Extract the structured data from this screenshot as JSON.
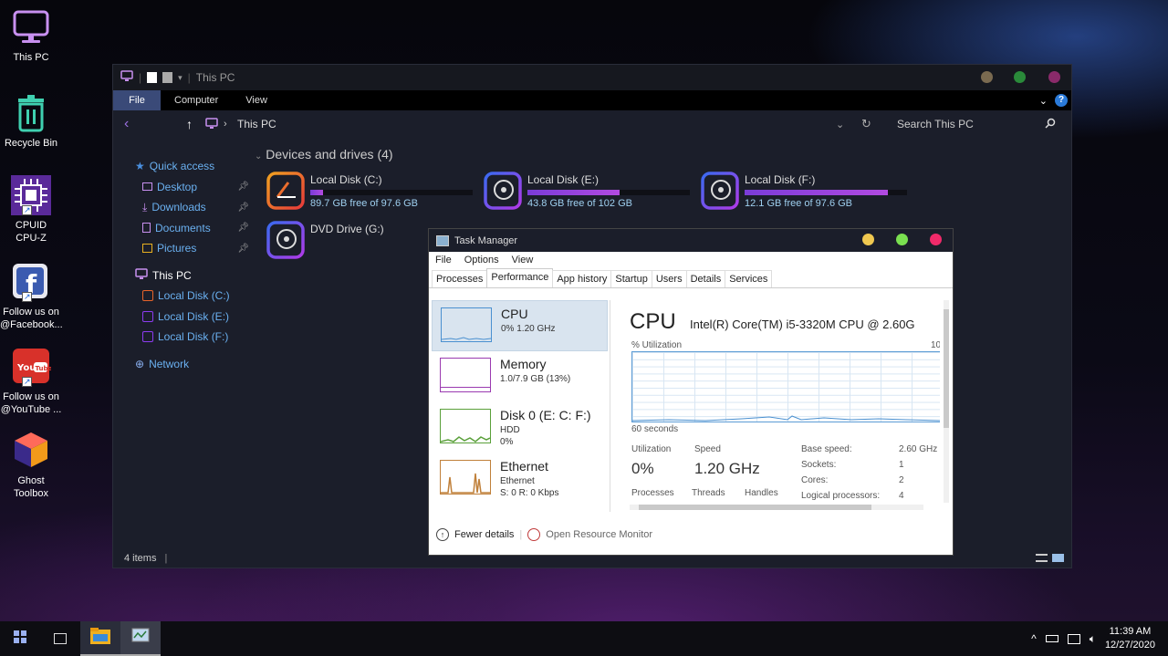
{
  "desktop": {
    "icons": [
      {
        "label": "This PC"
      },
      {
        "label": "Recycle Bin"
      },
      {
        "label_line1": "CPUID",
        "label_line2": "CPU-Z"
      },
      {
        "label_line1": "Follow us on",
        "label_line2": "@Facebook..."
      },
      {
        "label_line1": "Follow us on",
        "label_line2": "@YouTube ..."
      },
      {
        "label_line1": "Ghost",
        "label_line2": "Toolbox"
      }
    ]
  },
  "explorer": {
    "title": "This PC",
    "menu": [
      "File",
      "Computer",
      "View"
    ],
    "address": "This PC",
    "search_placeholder": "Search This PC",
    "sidebar": {
      "quick_access": "Quick access",
      "quick_items": [
        "Desktop",
        "Downloads",
        "Documents",
        "Pictures"
      ],
      "this_pc": "This PC",
      "drives": [
        "Local Disk (C:)",
        "Local Disk (E:)",
        "Local Disk (F:)"
      ],
      "network": "Network"
    },
    "section_title": "Devices and drives (4)",
    "drives": [
      {
        "name": "Local Disk (C:)",
        "free": "89.7 GB free of 97.6 GB",
        "used_fraction": 0.08,
        "color": "#e8642a"
      },
      {
        "name": "Local Disk (E:)",
        "free": "43.8 GB free of 102 GB",
        "used_fraction": 0.57,
        "color": "#8c3cf0"
      },
      {
        "name": "Local Disk (F:)",
        "free": "12.1 GB free of 97.6 GB",
        "used_fraction": 0.88,
        "color": "#8c3cf0"
      },
      {
        "name": "DVD Drive (G:)"
      }
    ],
    "status": "4 items"
  },
  "task_manager": {
    "title": "Task Manager",
    "menu": [
      "File",
      "Options",
      "View"
    ],
    "tabs": [
      "Processes",
      "Performance",
      "App history",
      "Startup",
      "Users",
      "Details",
      "Services"
    ],
    "active_tab": "Performance",
    "left_items": [
      {
        "name": "CPU",
        "sub": "0%  1.20 GHz"
      },
      {
        "name": "Memory",
        "sub": "1.0/7.9 GB (13%)"
      },
      {
        "name": "Disk 0 (E: C: F:)",
        "sub1": "HDD",
        "sub2": "0%"
      },
      {
        "name": "Ethernet",
        "sub1": "Ethernet",
        "sub2": "S: 0 R: 0 Kbps"
      }
    ],
    "detail": {
      "title": "CPU",
      "model": "Intel(R) Core(TM) i5-3320M CPU @ 2.60G",
      "graph_label": "% Utilization",
      "graph_max": "10",
      "graph_time": "60 seconds",
      "utilization_label": "Utilization",
      "utilization": "0%",
      "speed_label": "Speed",
      "speed": "1.20 GHz",
      "processes_label": "Processes",
      "threads_label": "Threads",
      "handles_label": "Handles",
      "specs": [
        {
          "k": "Base speed:",
          "v": "2.60 GHz"
        },
        {
          "k": "Sockets:",
          "v": "1"
        },
        {
          "k": "Cores:",
          "v": "2"
        },
        {
          "k": "Logical processors:",
          "v": "4"
        }
      ]
    },
    "footer": {
      "fewer": "Fewer details",
      "resmon": "Open Resource Monitor"
    }
  },
  "taskbar": {
    "time": "11:39 AM",
    "date": "12/27/2020"
  },
  "colors": {
    "accent": "#3a4a78",
    "purple": "#8c3cf0",
    "orange": "#e8642a"
  }
}
